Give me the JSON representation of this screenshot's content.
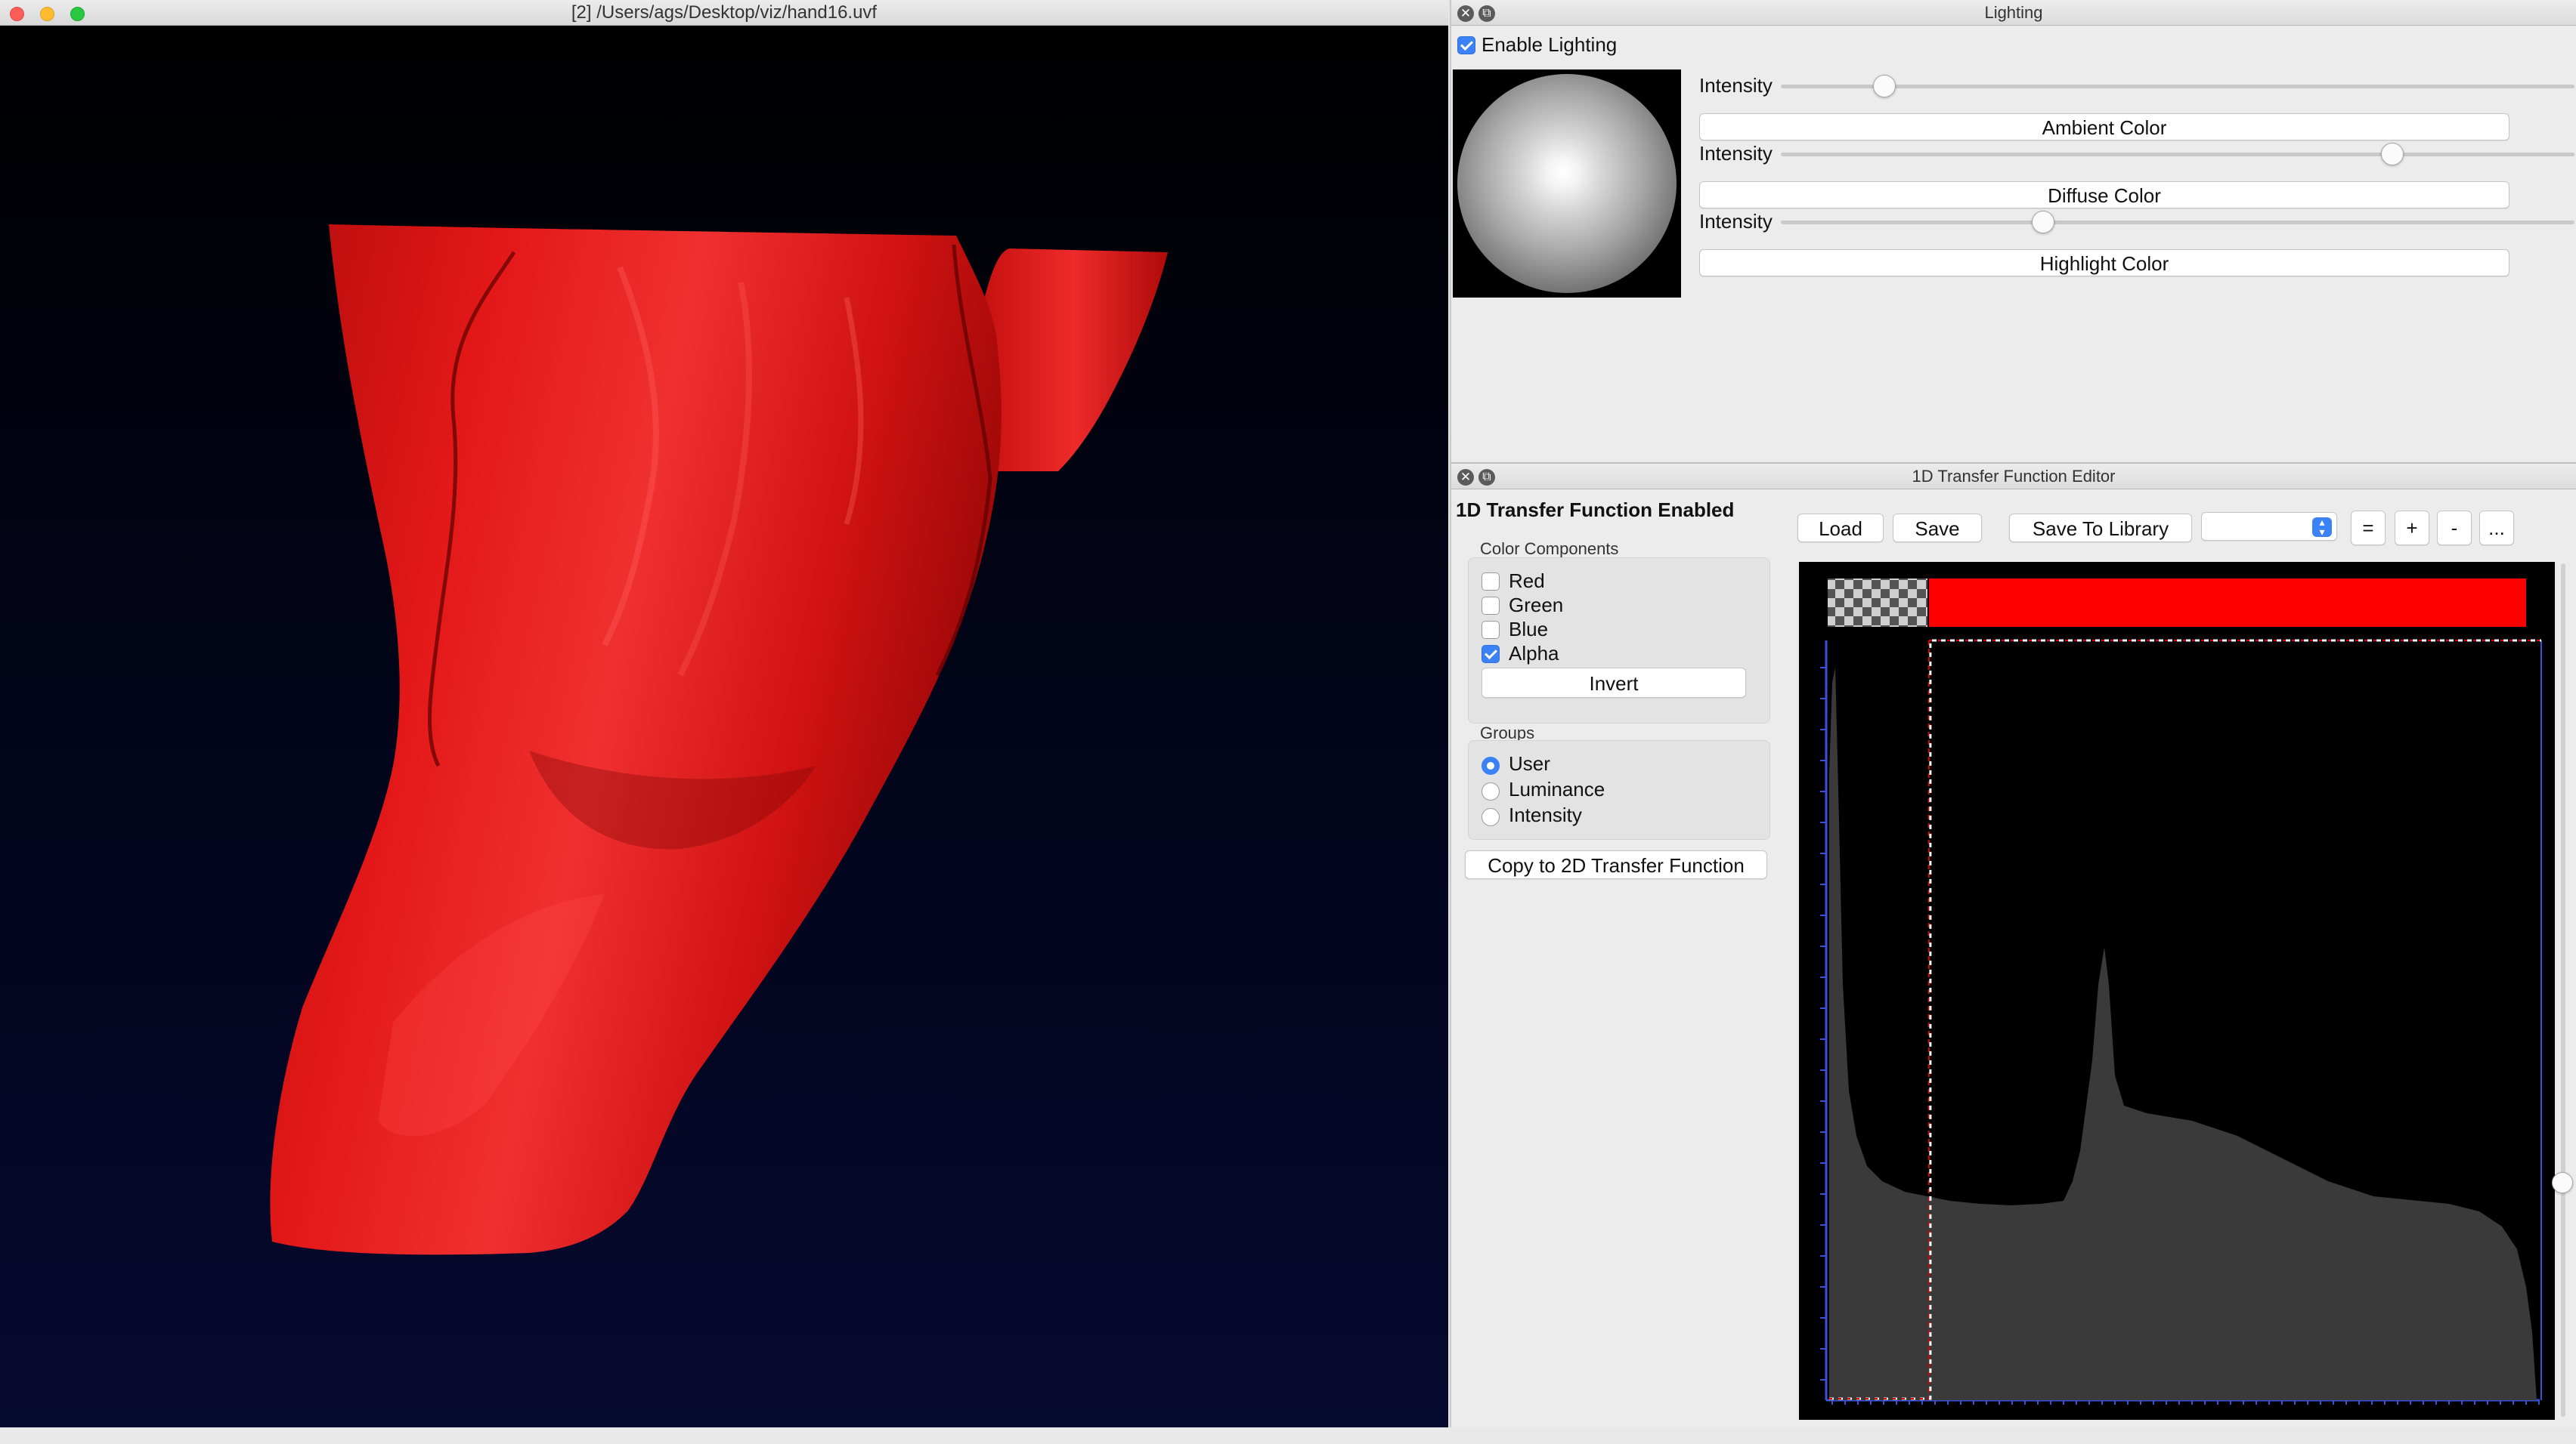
{
  "render_window": {
    "title": "[2] /Users/ags/Desktop/viz/hand16.uvf",
    "volume_color": "#e01515",
    "background_top": "#000000",
    "background_bottom": "#06092e"
  },
  "lighting": {
    "title": "Lighting",
    "enable_label": "Enable Lighting",
    "enabled": true,
    "ambient": {
      "intensity_label": "Intensity",
      "intensity": 0.13,
      "button": "Ambient Color"
    },
    "diffuse": {
      "intensity_label": "Intensity",
      "intensity": 0.77,
      "button": "Diffuse Color"
    },
    "highlight": {
      "intensity_label": "Intensity",
      "intensity": 0.33,
      "button": "Highlight Color"
    }
  },
  "tf_editor": {
    "title": "1D Transfer Function Editor",
    "status": "1D Transfer Function Enabled",
    "color_components": {
      "heading": "Color Components",
      "items": [
        {
          "label": "Red",
          "checked": false
        },
        {
          "label": "Green",
          "checked": false
        },
        {
          "label": "Blue",
          "checked": false
        },
        {
          "label": "Alpha",
          "checked": true
        }
      ],
      "invert_label": "Invert"
    },
    "groups": {
      "heading": "Groups",
      "items": [
        {
          "label": "User",
          "selected": true
        },
        {
          "label": "Luminance",
          "selected": false
        },
        {
          "label": "Intensity",
          "selected": false
        }
      ]
    },
    "copy_label": "Copy to 2D Transfer Function",
    "toolbar": {
      "load": "Load",
      "save": "Save",
      "save_library": "Save To Library",
      "library_selected": "",
      "equal": "=",
      "plus": "+",
      "minus": "-",
      "more": "..."
    },
    "colors": {
      "tf_red": "#ff0000",
      "histogram_fill": "#3a3a3a",
      "alpha_line": "#ffffff",
      "axis": "#3b4fd8",
      "accent": "#3b82f6"
    },
    "threshold": 0.14
  }
}
